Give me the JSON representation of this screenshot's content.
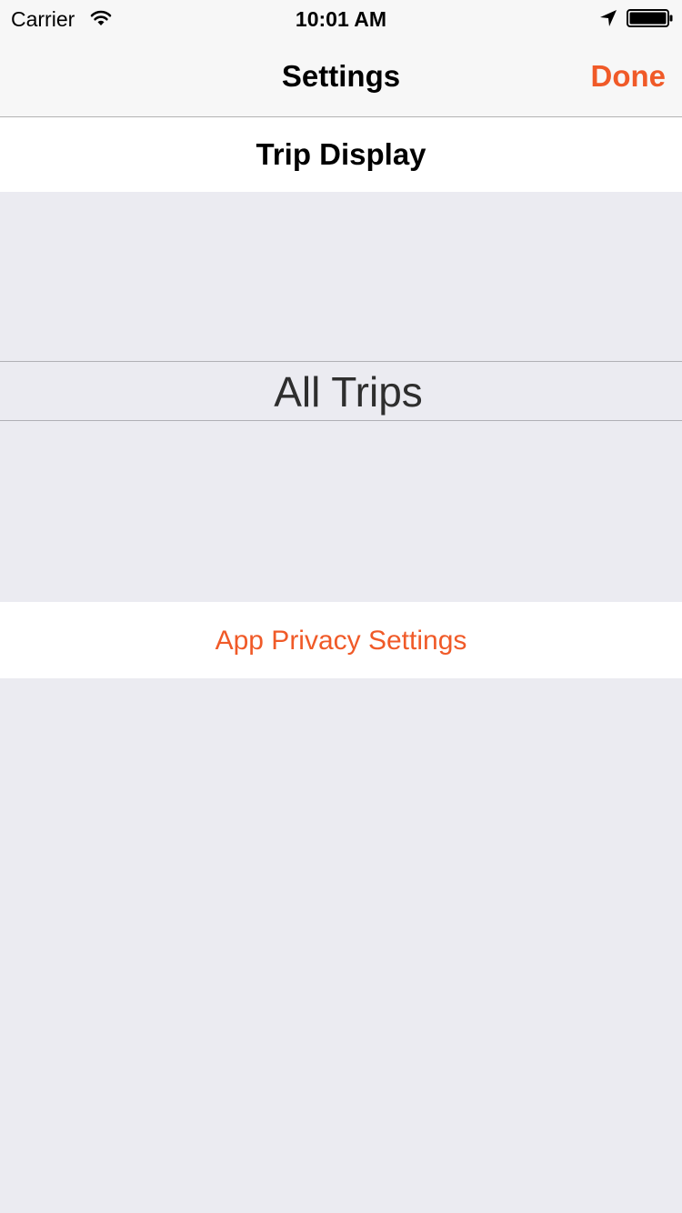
{
  "status_bar": {
    "carrier": "Carrier",
    "time": "10:01 AM",
    "icons": [
      "wifi-icon",
      "location-arrow-icon",
      "battery-icon"
    ]
  },
  "nav_bar": {
    "title": "Settings",
    "done_label": "Done"
  },
  "sections": {
    "trip_display_header": "Trip Display",
    "picker_selected": "All Trips",
    "privacy_link": "App Privacy Settings"
  },
  "colors": {
    "accent": "#f05a28",
    "background": "#ebebf1",
    "bar_background": "#f7f7f7"
  }
}
